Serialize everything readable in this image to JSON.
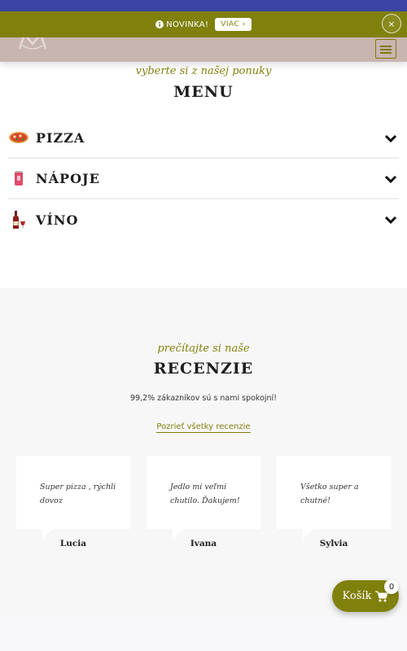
{
  "colors": {
    "accent": "#80800d",
    "top_bar": "#3b45a3",
    "header_bg": "#c9b5b0"
  },
  "announcement": {
    "icon": "info-circle-icon",
    "text": "NOVINKA!",
    "button_label": "VIAC ›",
    "close_label": "×"
  },
  "menu_section": {
    "script_title": "vyberte si z našej ponuky",
    "title": "MENU",
    "items": [
      {
        "label": "PIZZA",
        "icon": "pizza-icon"
      },
      {
        "label": "NÁPOJE",
        "icon": "drink-can-icon"
      },
      {
        "label": "VÍNO",
        "icon": "wine-bottle-icon"
      }
    ]
  },
  "reviews_section": {
    "script_title": "prečítajte si naše",
    "title": "RECENZIE",
    "satisfaction": "99,2% zákazníkov sú s nami spokojní!",
    "all_link": "Pozrieť všetky recenzie",
    "reviews": [
      {
        "text": "Super pizza , rýchli dovoz",
        "name": "Lucia"
      },
      {
        "text": "Jedlo mi veľmi chutilo. Ďakujem!",
        "name": "Ivana"
      },
      {
        "text": "Všetko super a chutné!",
        "name": "Sylvia"
      }
    ]
  },
  "cart": {
    "label": "Košík",
    "count": "0",
    "icon": "cart-icon"
  }
}
